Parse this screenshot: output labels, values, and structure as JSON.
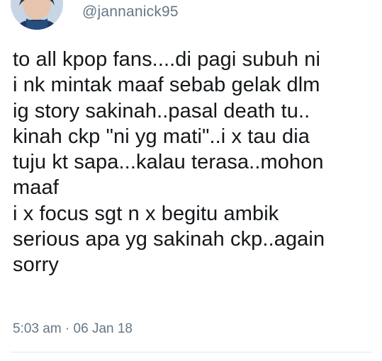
{
  "tweet": {
    "handle": "@jannanick95",
    "lines": [
      "to all kpop fans....di pagi subuh ni",
      "i nk mintak maaf sebab gelak dlm",
      "ig story sakinah..pasal death tu..",
      "kinah ckp \"ni yg mati\"..i x tau dia",
      "tuju kt sapa...kalau terasa..mohon",
      "maaf",
      "i x focus sgt n x begitu ambik",
      "serious apa yg sakinah ckp..again",
      "sorry"
    ],
    "timestamp": "5:03 am · 06 Jan 18"
  },
  "colors": {
    "text": "#14171a",
    "secondary": "#657786",
    "divider": "#e1e8ed"
  }
}
